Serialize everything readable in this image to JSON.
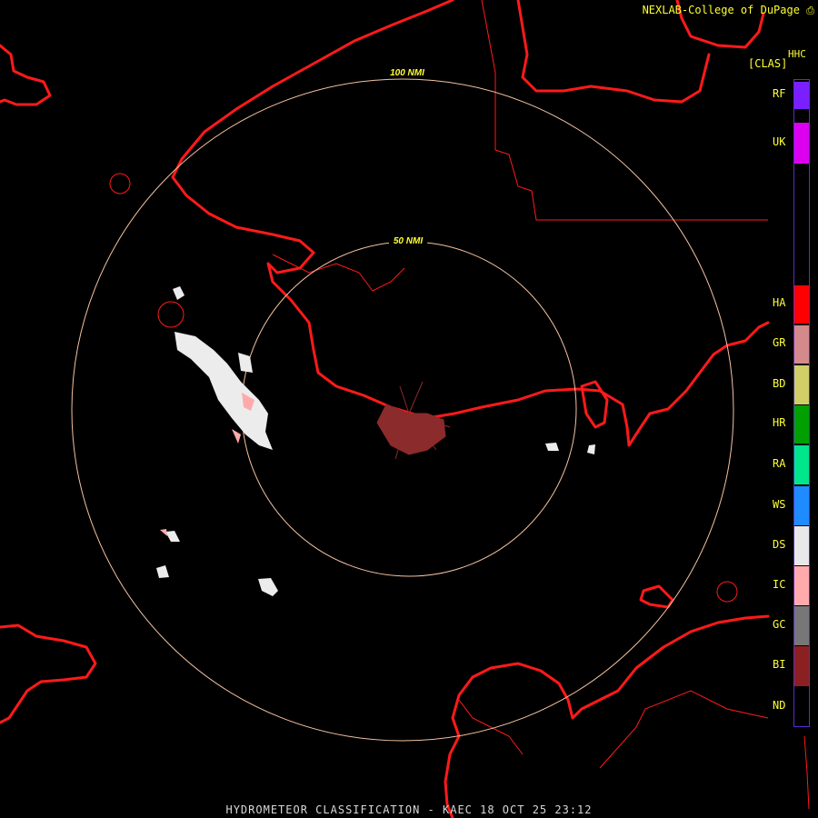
{
  "header": {
    "credit": "NEXLAB-College of DuPage",
    "product_code": "HHC",
    "mode": "[CLAS]"
  },
  "footer": {
    "title": "HYDROMETEOR CLASSIFICATION - KAEC 18 OCT 25 23:12"
  },
  "range_rings": [
    {
      "label": "100 NMI"
    },
    {
      "label": "50 NMI"
    }
  ],
  "legend": [
    {
      "code": "RF",
      "color": "#7a1fff"
    },
    {
      "code": "UK",
      "color": "#dd00f0"
    },
    {
      "code": "HA",
      "color": "#ff0000"
    },
    {
      "code": "GR",
      "color": "#d48a8a"
    },
    {
      "code": "BD",
      "color": "#cfcf66"
    },
    {
      "code": "HR",
      "color": "#00a000"
    },
    {
      "code": "RA",
      "color": "#00e68a"
    },
    {
      "code": "WS",
      "color": "#1e8cff"
    },
    {
      "code": "DS",
      "color": "#e8e8e8"
    },
    {
      "code": "IC",
      "color": "#ffaaaa"
    },
    {
      "code": "GC",
      "color": "#777777"
    },
    {
      "code": "BI",
      "color": "#8b2020"
    },
    {
      "code": "ND",
      "color": "#000000"
    }
  ],
  "colors": {
    "coastline": "#ff1a1a",
    "ring": "#f4c2a0",
    "ring_label": "#ffff33",
    "text": "#ffff33",
    "legend_border": "#5a2dd0"
  }
}
